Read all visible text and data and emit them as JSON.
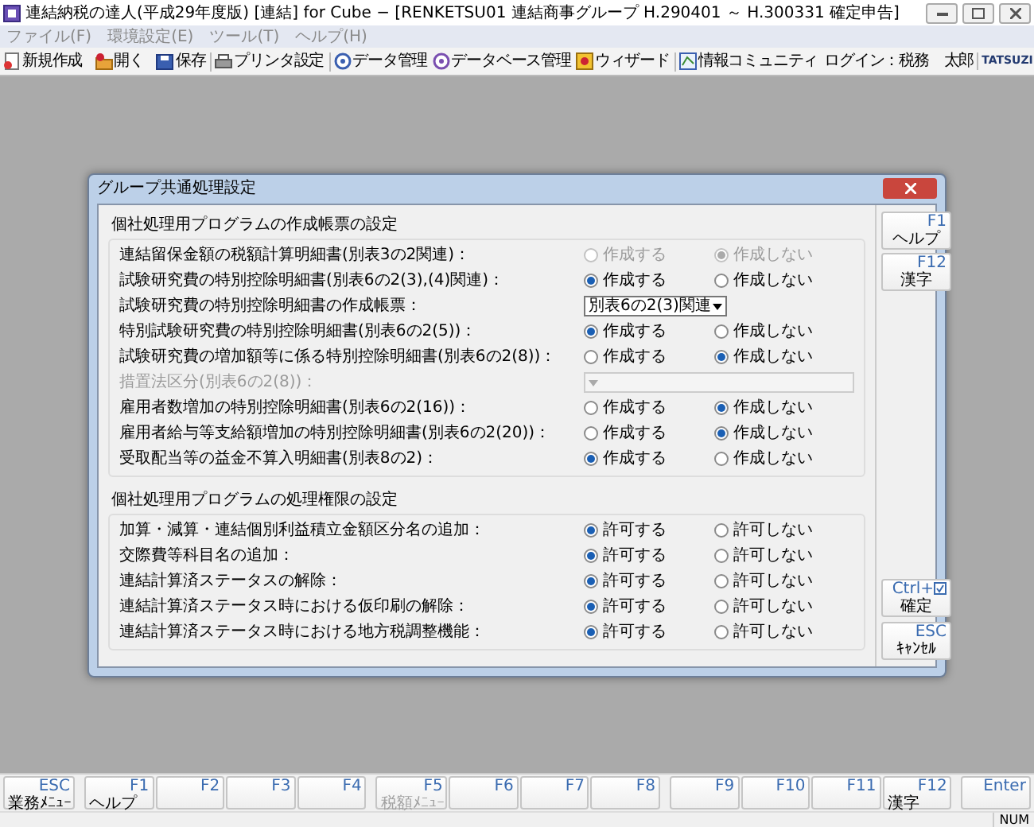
{
  "window": {
    "title": "連結納税の達人(平成29年度版) [連結] for Cube − [RENKETSU01 連結商事グループ H.290401 ～ H.300331 確定申告]"
  },
  "menu": [
    "ファイル(F)",
    "環境設定(E)",
    "ツール(T)",
    "ヘルプ(H)"
  ],
  "toolbar": {
    "items": [
      {
        "kind": "new",
        "label": "新規作成"
      },
      {
        "kind": "open",
        "label": "開く"
      },
      {
        "kind": "save",
        "label": "保存"
      },
      {
        "kind": "printer",
        "label": "プリンタ設定"
      },
      {
        "kind": "data",
        "label": "データ管理"
      },
      {
        "kind": "database",
        "label": "データベース管理"
      },
      {
        "kind": "wizard",
        "label": "ウィザード"
      },
      {
        "kind": "community",
        "label": "情報コミュニティ"
      }
    ],
    "login": "ログイン：税務　太郎",
    "logo": "TATSUZI"
  },
  "dialog": {
    "title": "グループ共通処理設定",
    "sections": [
      {
        "title": "個社処理用プログラムの作成帳票の設定",
        "rows": [
          {
            "kind": "radio",
            "label": "連結留保金額の税額計算明細書(別表3の2関連)：",
            "disabled": true,
            "options": [
              {
                "label": "作成する",
                "selected": false
              },
              {
                "label": "作成しない",
                "selected": true
              }
            ]
          },
          {
            "kind": "radio",
            "label": "試験研究費の特別控除明細書(別表6の2(3),(4)関連)：",
            "disabled": false,
            "options": [
              {
                "label": "作成する",
                "selected": true
              },
              {
                "label": "作成しない",
                "selected": false
              }
            ]
          },
          {
            "kind": "select",
            "label": "試験研究費の特別控除明細書の作成帳票：",
            "disabled": false,
            "value": "別表6の2(3)関連"
          },
          {
            "kind": "radio",
            "label": "特別試験研究費の特別控除明細書(別表6の2(5))：",
            "disabled": false,
            "options": [
              {
                "label": "作成する",
                "selected": true
              },
              {
                "label": "作成しない",
                "selected": false
              }
            ]
          },
          {
            "kind": "radio",
            "label": "試験研究費の増加額等に係る特別控除明細書(別表6の2(8))：",
            "disabled": false,
            "options": [
              {
                "label": "作成する",
                "selected": false
              },
              {
                "label": "作成しない",
                "selected": true
              }
            ]
          },
          {
            "kind": "select",
            "label": "措置法区分(別表6の2(8))：",
            "disabled": true
          },
          {
            "kind": "radio",
            "label": "雇用者数増加の特別控除明細書(別表6の2(16))：",
            "disabled": false,
            "options": [
              {
                "label": "作成する",
                "selected": false
              },
              {
                "label": "作成しない",
                "selected": true
              }
            ]
          },
          {
            "kind": "radio",
            "label": "雇用者給与等支給額増加の特別控除明細書(別表6の2(20))：",
            "disabled": false,
            "options": [
              {
                "label": "作成する",
                "selected": false
              },
              {
                "label": "作成しない",
                "selected": true
              }
            ]
          },
          {
            "kind": "radio",
            "label": "受取配当等の益金不算入明細書(別表8の2)：",
            "disabled": false,
            "options": [
              {
                "label": "作成する",
                "selected": true
              },
              {
                "label": "作成しない",
                "selected": false
              }
            ]
          }
        ]
      },
      {
        "title": "個社処理用プログラムの処理権限の設定",
        "rows": [
          {
            "kind": "radio",
            "label": "加算・減算・連結個別利益積立金額区分名の追加：",
            "disabled": false,
            "options": [
              {
                "label": "許可する",
                "selected": true
              },
              {
                "label": "許可しない",
                "selected": false
              }
            ]
          },
          {
            "kind": "radio",
            "label": "交際費等科目名の追加：",
            "disabled": false,
            "options": [
              {
                "label": "許可する",
                "selected": true
              },
              {
                "label": "許可しない",
                "selected": false
              }
            ]
          },
          {
            "kind": "radio",
            "label": "連結計算済ステータスの解除：",
            "disabled": false,
            "options": [
              {
                "label": "許可する",
                "selected": true
              },
              {
                "label": "許可しない",
                "selected": false
              }
            ]
          },
          {
            "kind": "radio",
            "label": "連結計算済ステータス時における仮印刷の解除：",
            "disabled": false,
            "options": [
              {
                "label": "許可する",
                "selected": true
              },
              {
                "label": "許可しない",
                "selected": false
              }
            ]
          },
          {
            "kind": "radio",
            "label": "連結計算済ステータス時における地方税調整機能：",
            "disabled": false,
            "options": [
              {
                "label": "許可する",
                "selected": true
              },
              {
                "label": "許可しない",
                "selected": false
              }
            ]
          }
        ]
      }
    ],
    "help_buttons": [
      {
        "key": "F1",
        "label": "ヘルプ"
      },
      {
        "key": "F12",
        "label": "漢字"
      }
    ],
    "action_buttons": [
      {
        "key": "Ctrl+",
        "label": "確定",
        "kind": "confirm"
      },
      {
        "key": "ESC",
        "label": "ｷｬﾝｾﾙ"
      }
    ]
  },
  "function_keys": [
    {
      "key": "ESC",
      "label": "業務ﾒﾆｭｰ",
      "disabled": false
    },
    {
      "key": "F1",
      "label": "ヘルプ",
      "disabled": false
    },
    {
      "key": "F2"
    },
    {
      "key": "F3"
    },
    {
      "key": "F4"
    },
    {
      "key": "F5",
      "label": "税額ﾒﾆｭｰ",
      "disabled": true
    },
    {
      "key": "F6"
    },
    {
      "key": "F7"
    },
    {
      "key": "F8"
    },
    {
      "key": "F9"
    },
    {
      "key": "F10"
    },
    {
      "key": "F11"
    },
    {
      "key": "F12",
      "label": "漢字",
      "disabled": false
    },
    {
      "key": "Enter"
    }
  ],
  "status_bar": {
    "indicator": "NUM"
  }
}
